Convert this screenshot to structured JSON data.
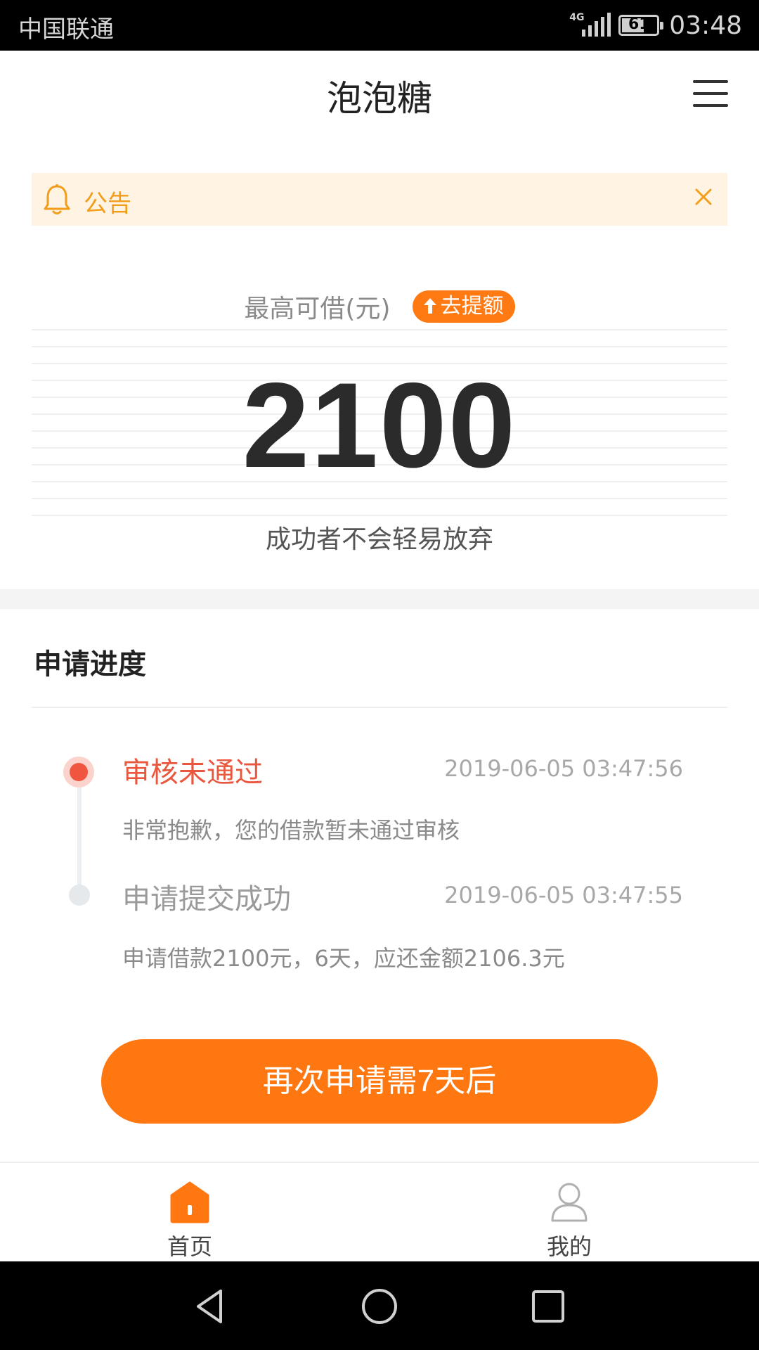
{
  "status_bar": {
    "carrier": "中国联通",
    "network": "4G",
    "battery": "61",
    "time": "03:48"
  },
  "header": {
    "title": "泡泡糖",
    "menu_icon": "hamburger-menu-icon"
  },
  "notice": {
    "icon": "bell-icon",
    "label": "公告",
    "close_icon": "close-icon"
  },
  "loan": {
    "max_label": "最高可借(元)",
    "raise_button": "去提额",
    "amount": "2100",
    "slogan": "成功者不会轻易放弃"
  },
  "progress": {
    "title": "申请进度",
    "steps": [
      {
        "status": "审核未通过",
        "time": "2019-06-05 03:47:56",
        "description": "非常抱歉，您的借款暂未通过审核"
      },
      {
        "status": "申请提交成功",
        "time": "2019-06-05 03:47:55",
        "description": "申请借款2100元，6天，应还金额2106.3元"
      }
    ]
  },
  "cta": {
    "label": "再次申请需7天后"
  },
  "bottom_nav": {
    "items": [
      {
        "label": "首页",
        "icon": "home-icon",
        "active": true
      },
      {
        "label": "我的",
        "icon": "user-icon",
        "active": false
      }
    ]
  },
  "colors": {
    "accent": "#ff7711",
    "notice_bg": "#fff4e3",
    "notice_text": "#f29d1b",
    "error": "#e9573f"
  }
}
